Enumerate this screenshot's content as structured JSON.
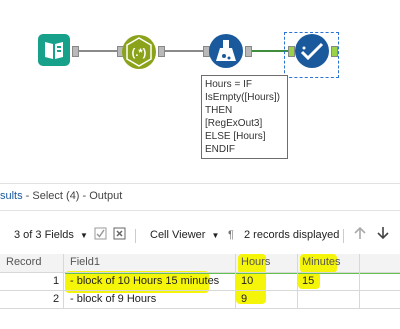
{
  "annotation": {
    "lines": [
      "Hours = IF",
      "IsEmpty([Hours])",
      "THEN",
      "[RegExOut3]",
      "ELSE [Hours]",
      "ENDIF"
    ]
  },
  "results": {
    "title_prefix": "sults",
    "title_rest": " - Select (4) - Output"
  },
  "toolbar": {
    "fields_label": "3 of 3 Fields",
    "viewer_label": "Cell Viewer",
    "records_label": "2 records displayed"
  },
  "table": {
    "columns": [
      "Record",
      "Field1",
      "Hours",
      "Minutes"
    ],
    "rows": [
      {
        "record": "1",
        "field1": "- block of 10 Hours 15 minutes",
        "hours": "10",
        "minutes": "15"
      },
      {
        "record": "2",
        "field1": "- block of 9 Hours",
        "hours": "9",
        "minutes": ""
      }
    ]
  },
  "colors": {
    "highlight": "#f5f50a",
    "accent": "#1a5aa0"
  },
  "icons": [
    "book-input-icon",
    "regex-icon",
    "formula-flask-icon",
    "select-check-icon",
    "checkbox-icon",
    "x-box-icon",
    "pilcrow-icon",
    "arrow-up-icon",
    "arrow-down-icon"
  ]
}
